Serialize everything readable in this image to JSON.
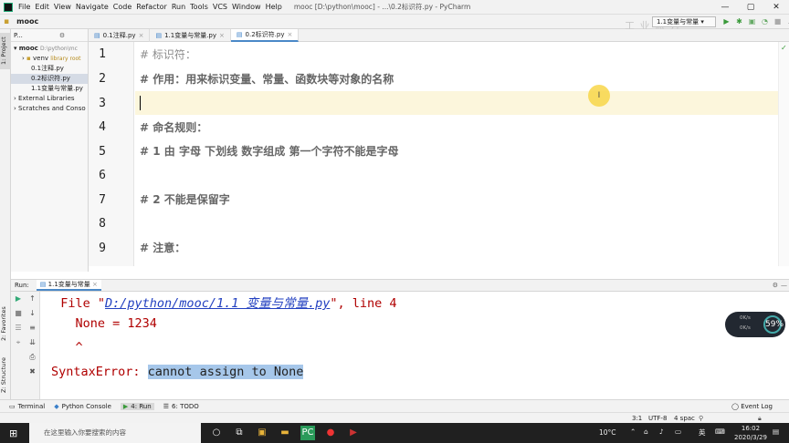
{
  "window": {
    "title": "mooc [D:\\python\\mooc] - ...\\0.2标识符.py - PyCharm",
    "menu": [
      "File",
      "Edit",
      "View",
      "Navigate",
      "Code",
      "Refactor",
      "Run",
      "Tools",
      "VCS",
      "Window",
      "Help"
    ],
    "controls": [
      "—",
      "▢",
      "✕"
    ]
  },
  "navbar": {
    "breadcrumb": "mooc",
    "file": "0.2标识符.py",
    "run_config": "1.1变量与常量",
    "watermark": "工 业 派 方"
  },
  "left_strip": {
    "project_tab": "1: Project",
    "favorites_tab": "2: Favorites",
    "structure_tab": "Z: Structure"
  },
  "project": {
    "header": "P...",
    "tree": [
      {
        "label": "mooc",
        "extra": "D:\\python\\mc",
        "bold": true
      },
      {
        "label": "venv",
        "extra": "library root"
      },
      {
        "label": "0.1注释.py"
      },
      {
        "label": "0.2标识符.py",
        "selected": true
      },
      {
        "label": "1.1变量与常量.py"
      },
      {
        "label": "External Libraries"
      },
      {
        "label": "Scratches and Conso"
      }
    ]
  },
  "tabs": [
    {
      "label": "0.1注释.py",
      "active": false
    },
    {
      "label": "1.1变量与常量.py",
      "active": false
    },
    {
      "label": "0.2标识符.py",
      "active": true
    }
  ],
  "editor": {
    "line_numbers": [
      "1",
      "2",
      "3",
      "4",
      "5",
      "6",
      "7",
      "8",
      "9"
    ],
    "lines": [
      "# 标识符：",
      "# 作用：用来标识变量、常量、函数块等对象的名称",
      "",
      "# 命名规则：",
      "# 1 由 字母 下划线 数字组成 第一个字符不能是字母",
      "",
      "# 2 不能是保留字",
      "",
      "# 注意："
    ],
    "current_line": 3,
    "mouse_cursor_glyph": "I"
  },
  "run": {
    "label": "Run:",
    "config_tab": "1.1变量与常量",
    "console": {
      "file_prefix": "  File \"",
      "file_link": "D:/python/mooc/1.1 变量与常量.py",
      "file_suffix": "\", line 4",
      "code_line": "    None = 1234",
      "caret_line": "    ^",
      "error_prefix": "SyntaxError: ",
      "error_selected": "cannot assign to None"
    }
  },
  "bottom_tabs": [
    {
      "label": "Terminal",
      "active": false
    },
    {
      "label": "Python Console",
      "active": false
    },
    {
      "label": "4: Run",
      "active": true
    },
    {
      "label": "6: TODO",
      "active": false
    }
  ],
  "event_log": "Event Log",
  "statusbar": {
    "position": "3:1",
    "encoding": "UTF-8",
    "indent": "4 spac"
  },
  "net_widget": {
    "percent": "59%",
    "up": "0K/s",
    "down": "0K/s"
  },
  "taskbar": {
    "search_placeholder": "在这里输入你要搜索的内容",
    "temperature": "10°C",
    "ime": "英",
    "time": "16:02",
    "date": "2020/3/29"
  }
}
